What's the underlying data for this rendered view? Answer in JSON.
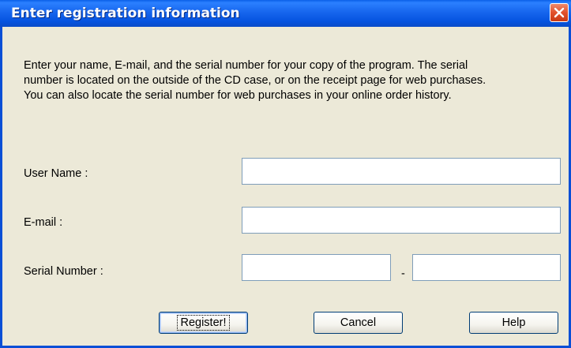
{
  "window": {
    "title": "Enter registration information",
    "close_icon": "close-x-icon"
  },
  "description": {
    "line1": "Enter your name, E-mail, and the serial number for your copy of the program. The serial",
    "line2": "number is located on the outside of the CD case, or on the receipt page for web purchases.",
    "line3": "You can also locate the serial number for web purchases in your online order history."
  },
  "form": {
    "username_label": "User Name :",
    "username_value": "",
    "email_label": "E-mail :",
    "email_value": "",
    "serial_label": "Serial Number :",
    "serial_part1_value": "",
    "serial_separator": "-",
    "serial_part2_value": ""
  },
  "buttons": {
    "register_label": "Register!",
    "cancel_label": "Cancel",
    "help_label": "Help"
  },
  "colors": {
    "titlebar": "#0a5fe8",
    "dialog_background": "#ece9d8",
    "close_button": "#e2512c",
    "field_border": "#7f9db9"
  }
}
